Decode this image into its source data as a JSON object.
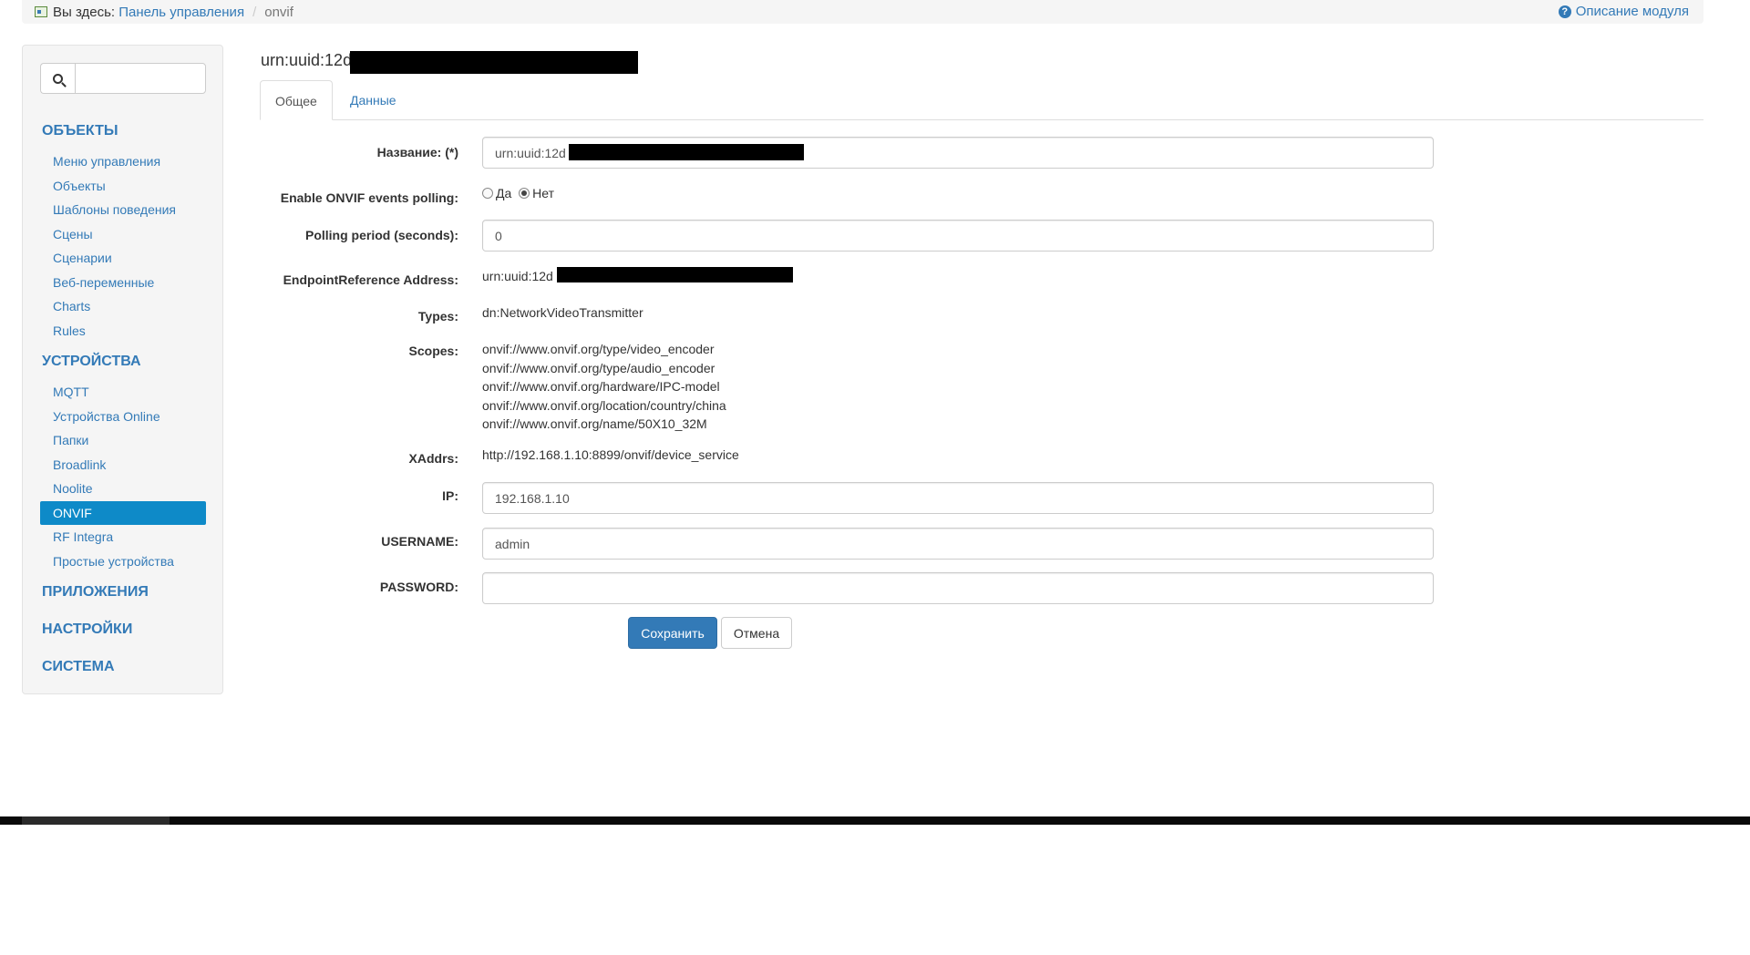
{
  "breadcrumb": {
    "prefix": "Вы здесь:",
    "home": "Панель управления",
    "separator": "/",
    "current": "onvif",
    "help_label": "Описание модуля"
  },
  "sidebar": {
    "search_placeholder": "",
    "sections": [
      {
        "header": "ОБЪЕКТЫ",
        "items": [
          "Меню управления",
          "Объекты",
          "Шаблоны поведения",
          "Сцены",
          "Сценарии",
          "Веб-переменные",
          "Charts",
          "Rules"
        ]
      },
      {
        "header": "УСТРОЙСТВА",
        "items": [
          "MQTT",
          "Устройства Online",
          "Папки",
          "Broadlink",
          "Noolite",
          "ONVIF",
          "RF Integra",
          "Простые устройства"
        ],
        "active": "ONVIF"
      },
      {
        "header": "ПРИЛОЖЕНИЯ",
        "items": []
      },
      {
        "header": "НАСТРОЙКИ",
        "items": []
      },
      {
        "header": "СИСТЕМА",
        "items": []
      }
    ]
  },
  "main": {
    "title": "urn:uuid:12d",
    "tabs": [
      {
        "label": "Общее",
        "active": true
      },
      {
        "label": "Данные",
        "active": false
      }
    ],
    "form": {
      "name_label": "Название: (*)",
      "name_value": "urn:uuid:12d",
      "polling_label": "Enable ONVIF events polling:",
      "polling_yes": "Да",
      "polling_no": "Нет",
      "polling_selected": "Нет",
      "period_label": "Polling period (seconds):",
      "period_value": "0",
      "endpoint_label": "EndpointReference Address:",
      "endpoint_value": "urn:uuid:12d",
      "types_label": "Types:",
      "types_value": "dn:NetworkVideoTransmitter",
      "scopes_label": "Scopes:",
      "scopes": [
        "onvif://www.onvif.org/type/video_encoder",
        "onvif://www.onvif.org/type/audio_encoder",
        "onvif://www.onvif.org/hardware/IPC-model",
        "onvif://www.onvif.org/location/country/china",
        "onvif://www.onvif.org/name/50X10_32M"
      ],
      "xaddrs_label": "XAddrs:",
      "xaddrs_value": "http://192.168.1.10:8899/onvif/device_service",
      "ip_label": "IP:",
      "ip_value": "192.168.1.10",
      "username_label": "USERNAME:",
      "username_value": "admin",
      "password_label": "PASSWORD:",
      "password_value": "",
      "save_label": "Сохранить",
      "cancel_label": "Отмена"
    }
  }
}
